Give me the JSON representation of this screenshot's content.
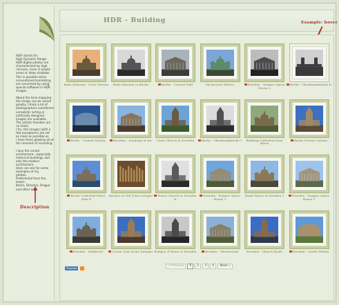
{
  "header": {
    "title": "HDR - Building"
  },
  "annotations": {
    "example_hover": "Example: hover",
    "description": "Description"
  },
  "sidebar": {
    "text": "HDR stands for\nHigh Dynamic Range.\nHDR-digital photos are\ncharacterized by high\nrichness, even in bright\nareas or deep shadows.\nThis is possible when\nconventional bracketing\nare converted by using\nspecial software in HDR\nimages.\n\nAbout the tone mapping\nthe image can be varied\ngreatly. I think a lot of\nphotographers sometimes\nunrealistic acting or\nartificially designed\nimages are available.\nThe artistic freedom are\nno limits.\nI try, the images (with a\nfew exceptions) are set\nas close as possible as\nI have them glowing all at\nthe moment of recording.\n\nI love the varied\narchitecture - especially\nhistorical buildings, but\nalso the modern\narchitecture.\nHere can see for some\nexamples of my\nphotos.\nPreferential from the\ntowns:\nBerlin, Dresden, Prague\nand other one!"
  },
  "gallery": [
    {
      "caption": "Bode Museum - Color Version",
      "icon": false,
      "scene": "museum-dome",
      "hover": false
    },
    {
      "caption": "Bode Museum in Berlin",
      "icon": false,
      "scene": "museum-bw",
      "hover": false
    },
    {
      "caption": "Berlin - Concert Hall",
      "icon": true,
      "scene": "concert-hall",
      "hover": false
    },
    {
      "caption": "My favorite Motive",
      "icon": false,
      "scene": "green-domes",
      "hover": false
    },
    {
      "caption": "Dresden - Semper Opera House 3",
      "icon": true,
      "scene": "opera-bw",
      "hover": false
    },
    {
      "caption": "Berlin - Oberbaumbrücke II",
      "icon": true,
      "scene": "bridge-bw",
      "hover": true
    },
    {
      "caption": "Berlin - Central Station",
      "icon": true,
      "scene": "station",
      "hover": false
    },
    {
      "caption": "Dresden - Academy of Art",
      "icon": true,
      "scene": "academy",
      "hover": false
    },
    {
      "caption": "Court Church in Dresden",
      "icon": false,
      "scene": "court-church",
      "hover": false
    },
    {
      "caption": "Berlin - Oberbaumbrücke I",
      "icon": true,
      "scene": "tower-bw",
      "hover": false
    },
    {
      "caption": "Building Cathedral from above",
      "icon": false,
      "scene": "cathedral-above",
      "hover": false
    },
    {
      "caption": "Berlin Victory Column",
      "icon": true,
      "scene": "church-front",
      "hover": false
    },
    {
      "caption": "Berlin Cathedral Water Side II",
      "icon": true,
      "scene": "cathedral-water",
      "hover": false
    },
    {
      "caption": "Basilica in Old Town Cologne",
      "icon": false,
      "scene": "basilica",
      "hover": false
    },
    {
      "caption": "Prince Church in Dresden II",
      "icon": true,
      "scene": "prince-church",
      "hover": false
    },
    {
      "caption": "Dresden - Semper Opera House 2",
      "icon": true,
      "scene": "opera-2",
      "hover": false
    },
    {
      "caption": "Royal Palace in Dresden 1",
      "icon": false,
      "scene": "royal-palace",
      "hover": false
    },
    {
      "caption": "Dresden - Semper Opera House 1",
      "icon": true,
      "scene": "opera-1",
      "hover": false
    },
    {
      "caption": "Dresden - Hofkirche",
      "icon": true,
      "scene": "hofkirche",
      "hover": false
    },
    {
      "caption": "Crown Gate of the Zwinger",
      "icon": true,
      "scene": "crown-gate",
      "hover": false
    },
    {
      "caption": "Bridges of Rome in Dresden",
      "icon": false,
      "scene": "bridges",
      "hover": false
    },
    {
      "caption": "Dresden - Wernersand",
      "icon": true,
      "scene": "wernersand",
      "hover": false
    },
    {
      "caption": "Dresden - Church Roofs",
      "icon": false,
      "scene": "church-roofs",
      "hover": false
    },
    {
      "caption": "Dresden - Castle Pillnitz",
      "icon": true,
      "scene": "pillnitz",
      "hover": false
    }
  ],
  "pagination": {
    "previous": "« Previous",
    "pages": [
      "1",
      "2",
      "3",
      "4"
    ],
    "current": "1",
    "next": "Next »"
  },
  "footer": {
    "feed_button": "Thumbs"
  },
  "colors": {
    "accent_red": "#a83226",
    "thumb_frame": "#c7d09e",
    "title_gray": "#8a9676"
  }
}
